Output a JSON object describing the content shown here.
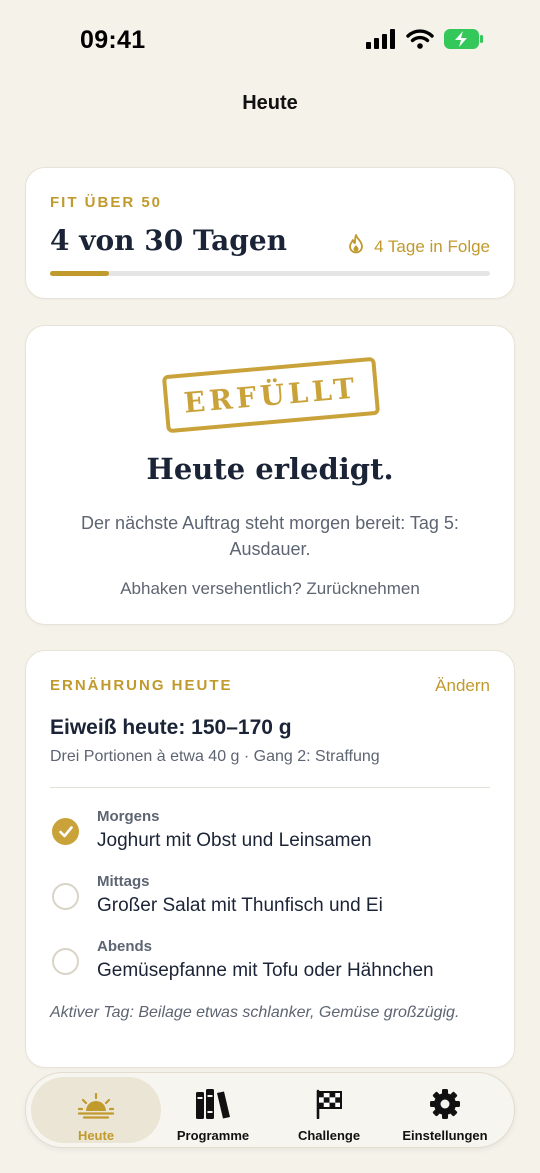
{
  "status_bar": {
    "time": "09:41"
  },
  "nav": {
    "title": "Heute"
  },
  "program_card": {
    "eyebrow": "FIT ÜBER 50",
    "title": "4 von 30 Tagen",
    "streak": "4 Tage in Folge",
    "progress_fraction": 0.133,
    "accent_color": "#c19a2e"
  },
  "done_card": {
    "stamp": "ERFÜLLT",
    "title": "Heute erledigt.",
    "text": "Der nächste Auftrag steht morgen bereit: Tag 5: Ausdauer.",
    "undo_prefix": "Abhaken versehentlich?",
    "undo_link": "Zurücknehmen"
  },
  "nutrition_card": {
    "eyebrow": "ERNÄHRUNG HEUTE",
    "change_label": "Ändern",
    "protein_title": "Eiweiß heute: 150–170 g",
    "protein_sub": "Drei Portionen à etwa 40 g · Gang 2: Straffung",
    "meals": [
      {
        "label": "Morgens",
        "text": "Joghurt mit Obst und Leinsamen",
        "checked": true
      },
      {
        "label": "Mittags",
        "text": "Großer Salat mit Thunfisch und Ei",
        "checked": false
      },
      {
        "label": "Abends",
        "text": "Gemüsepfanne mit Tofu oder Hähnchen",
        "checked": false
      }
    ],
    "note": "Aktiver Tag: Beilage etwas schlanker, Gemüse großzügig."
  },
  "tabbar": {
    "tabs": [
      {
        "label": "Heute",
        "icon": "sunrise-icon",
        "active": true
      },
      {
        "label": "Programme",
        "icon": "books-icon",
        "active": false
      },
      {
        "label": "Challenge",
        "icon": "checkered-flag-icon",
        "active": false
      },
      {
        "label": "Einstellungen",
        "icon": "gear-icon",
        "active": false
      }
    ]
  }
}
